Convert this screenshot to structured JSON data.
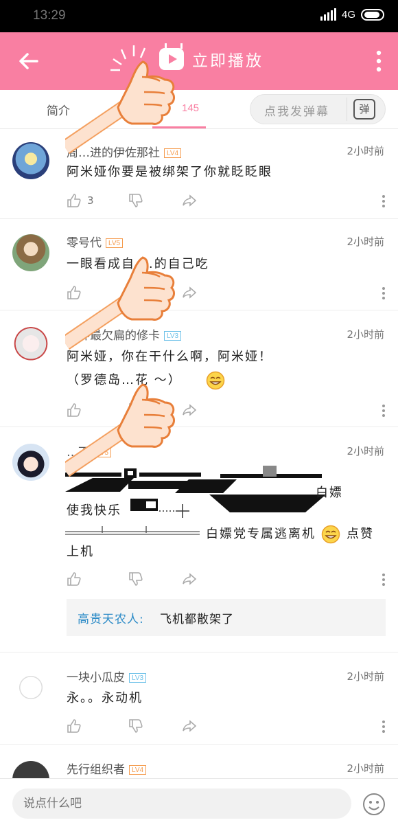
{
  "status": {
    "time": "13:29",
    "network": "4G"
  },
  "appbar": {
    "title": "立即播放"
  },
  "tabs": {
    "intro": "简介",
    "comments": "145"
  },
  "danmaku": {
    "placeholder": "点我发弹幕",
    "icon_text": "弹"
  },
  "comments": [
    {
      "user": "周…进的伊佐那社",
      "level": "LV4",
      "time": "2小时前",
      "lines": [
        "阿米娅你要是被绑架了你就眨眨眼"
      ],
      "likes": "3"
    },
    {
      "user": "零号代",
      "level": "LV5",
      "time": "2小时前",
      "lines": [
        "一眼看成自 …的自己吃"
      ],
      "likes": ""
    },
    {
      "user": "…界最欠扁的修卡",
      "level": "LV3",
      "time": "2小时前",
      "lines": [
        "阿米娅，你在干什么啊，阿米娅！",
        "（罗德岛…花 ～）"
      ],
      "likes": ""
    },
    {
      "user": "…下",
      "level": "LV5",
      "time": "2小时前",
      "lines": [
        "白嫖",
        "使我快乐",
        "白嫖党专属逃离机",
        "点赞",
        "上机"
      ],
      "likes": ""
    },
    {
      "user": "一块小瓜皮",
      "level": "LV3",
      "time": "2小时前",
      "lines": [
        "永。。永动机"
      ],
      "likes": ""
    },
    {
      "user": "先行组织者",
      "level": "LV4",
      "time": "2小时前",
      "lines": [],
      "likes": ""
    }
  ],
  "reply": {
    "name": "高贵天农人:",
    "text": "飞机都散架了"
  },
  "bottom": {
    "placeholder": "说点什么吧"
  },
  "colors": {
    "accent": "#f97fa2",
    "link": "#2c8bc7",
    "lv_orange": "#f59b4d",
    "lv_blue": "#6bc0e8"
  }
}
